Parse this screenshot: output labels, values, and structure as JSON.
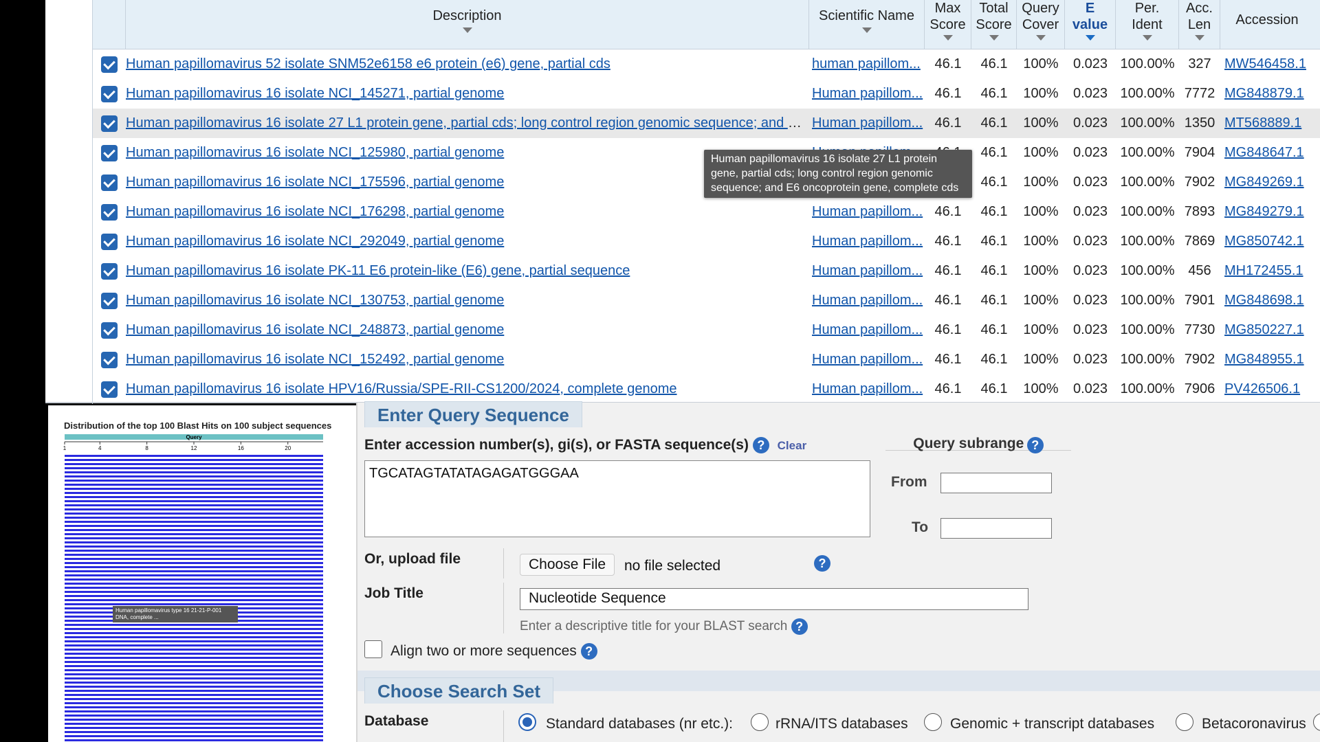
{
  "results": {
    "headers": {
      "description": "Description",
      "scientific_name": "Scientific Name",
      "max_score_1": "Max",
      "max_score_2": "Score",
      "total_score_1": "Total",
      "total_score_2": "Score",
      "query_cover_1": "Query",
      "query_cover_2": "Cover",
      "e_value_1": "E",
      "e_value_2": "value",
      "per_ident_1": "Per.",
      "per_ident_2": "Ident",
      "acc_len_1": "Acc.",
      "acc_len_2": "Len",
      "accession": "Accession"
    },
    "rows": [
      {
        "description": "Human papillomavirus 52 isolate SNM52e6158 e6 protein (e6) gene, partial cds",
        "sci": "human papillom...",
        "max": "46.1",
        "total": "46.1",
        "cover": "100%",
        "evalue": "0.023",
        "ident": "100.00%",
        "len": "327",
        "acc": "MW546458.1"
      },
      {
        "description": "Human papillomavirus 16 isolate NCI_145271, partial genome",
        "sci": "Human papillom...",
        "max": "46.1",
        "total": "46.1",
        "cover": "100%",
        "evalue": "0.023",
        "ident": "100.00%",
        "len": "7772",
        "acc": "MG848879.1"
      },
      {
        "description": "Human papillomavirus 16 isolate 27 L1 protein gene, partial cds; long control region genomic sequence; and E...",
        "sci": "Human papillom...",
        "max": "46.1",
        "total": "46.1",
        "cover": "100%",
        "evalue": "0.023",
        "ident": "100.00%",
        "len": "1350",
        "acc": "MT568889.1"
      },
      {
        "description": "Human papillomavirus 16 isolate NCI_125980, partial genome",
        "sci": "Human papillom...",
        "max": "46.1",
        "total": "46.1",
        "cover": "100%",
        "evalue": "0.023",
        "ident": "100.00%",
        "len": "7904",
        "acc": "MG848647.1"
      },
      {
        "description": "Human papillomavirus 16 isolate NCI_175596, partial genome",
        "sci": "Human papillom...",
        "max": "46.1",
        "total": "46.1",
        "cover": "100%",
        "evalue": "0.023",
        "ident": "100.00%",
        "len": "7902",
        "acc": "MG849269.1"
      },
      {
        "description": "Human papillomavirus 16 isolate NCI_176298, partial genome",
        "sci": "Human papillom...",
        "max": "46.1",
        "total": "46.1",
        "cover": "100%",
        "evalue": "0.023",
        "ident": "100.00%",
        "len": "7893",
        "acc": "MG849279.1"
      },
      {
        "description": "Human papillomavirus 16 isolate NCI_292049, partial genome",
        "sci": "Human papillom...",
        "max": "46.1",
        "total": "46.1",
        "cover": "100%",
        "evalue": "0.023",
        "ident": "100.00%",
        "len": "7869",
        "acc": "MG850742.1"
      },
      {
        "description": "Human papillomavirus 16 isolate PK-11 E6 protein-like (E6) gene, partial sequence",
        "sci": "Human papillom...",
        "max": "46.1",
        "total": "46.1",
        "cover": "100%",
        "evalue": "0.023",
        "ident": "100.00%",
        "len": "456",
        "acc": "MH172455.1"
      },
      {
        "description": "Human papillomavirus 16 isolate NCI_130753, partial genome",
        "sci": "Human papillom...",
        "max": "46.1",
        "total": "46.1",
        "cover": "100%",
        "evalue": "0.023",
        "ident": "100.00%",
        "len": "7901",
        "acc": "MG848698.1"
      },
      {
        "description": "Human papillomavirus 16 isolate NCI_248873, partial genome",
        "sci": "Human papillom...",
        "max": "46.1",
        "total": "46.1",
        "cover": "100%",
        "evalue": "0.023",
        "ident": "100.00%",
        "len": "7730",
        "acc": "MG850227.1"
      },
      {
        "description": "Human papillomavirus 16 isolate NCI_152492, partial genome",
        "sci": "Human papillom...",
        "max": "46.1",
        "total": "46.1",
        "cover": "100%",
        "evalue": "0.023",
        "ident": "100.00%",
        "len": "7902",
        "acc": "MG848955.1"
      },
      {
        "description": "Human papillomavirus 16 isolate HPV16/Russia/SPE-RII-CS1200/2024, complete genome",
        "sci": "Human papillom...",
        "max": "46.1",
        "total": "46.1",
        "cover": "100%",
        "evalue": "0.023",
        "ident": "100.00%",
        "len": "7906",
        "acc": "PV426506.1"
      }
    ],
    "tooltip": "Human papillomavirus 16 isolate 27 L1 protein gene, partial cds; long control region genomic sequence; and E6 oncoprotein gene, complete cds"
  },
  "distribution": {
    "title": "Distribution of the top 100 Blast Hits on 100 subject sequences",
    "query_label": "Query",
    "ticks": [
      "1",
      "4",
      "8",
      "12",
      "16",
      "20"
    ],
    "tooltip": "Human papillomavirus type 16 21-21-P-001 DNA, complete ..."
  },
  "form": {
    "enter_query_tab": "Enter Query Sequence",
    "accession_label": "Enter accession number(s), gi(s), or FASTA sequence(s)",
    "clear": "Clear",
    "query_value": "TGCATAGTATATAGAGATGGGAA",
    "subrange_label": "Query subrange",
    "from_label": "From",
    "to_label": "To",
    "upload_label": "Or, upload file",
    "choose_file": "Choose File",
    "no_file": "no file selected",
    "job_title_label": "Job Title",
    "job_title_value": "Nucleotide Sequence",
    "job_title_hint": "Enter a descriptive title for your BLAST search",
    "align_label": "Align two or more sequences",
    "choose_search_set_tab": "Choose Search Set",
    "database_label": "Database",
    "db_options": [
      "Standard databases (nr etc.):",
      "rRNA/ITS databases",
      "Genomic + transcript databases",
      "Betacoronavirus"
    ],
    "help_glyph": "?"
  }
}
